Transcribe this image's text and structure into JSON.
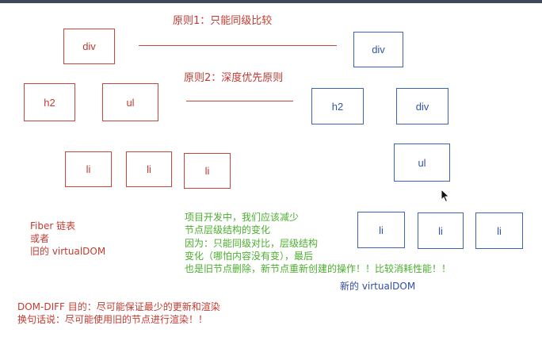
{
  "principles": {
    "p1": "原则1：只能同级比较",
    "p2": "原则2：深度优先原则"
  },
  "old_tree": {
    "root": "div",
    "level2": [
      "h2",
      "ul"
    ],
    "level3": [
      "li",
      "li",
      "li"
    ]
  },
  "new_tree": {
    "root": "div",
    "level2": [
      "h2",
      "div"
    ],
    "level3": [
      "ul"
    ],
    "level4": [
      "li",
      "li",
      "li"
    ],
    "caption": "新的 virtualDOM"
  },
  "old_caption": [
    "Fiber 链表",
    "或者",
    "旧的 virtualDOM"
  ],
  "project_note": [
    "项目开发中，我们应该减少",
    "节点层级结构的变化",
    "因为：只能同级对比，层级结构",
    "变化（哪怕内容没有变），最后",
    "也是旧节点删除，新节点重新创建的操作！！比较消耗性能！！"
  ],
  "dom_diff_note": [
    "DOM-DIFF 目的：尽可能保证最少的更新和渲染",
    "换句话说：尽可能使用旧的节点进行渲染！！"
  ],
  "colors": {
    "old_tree": "#c8453b",
    "new_tree": "#3d63b8",
    "note": "#4cae2f",
    "topbar": "#3e4a5a"
  },
  "icons": {
    "cursor": "mouse-pointer-icon"
  }
}
